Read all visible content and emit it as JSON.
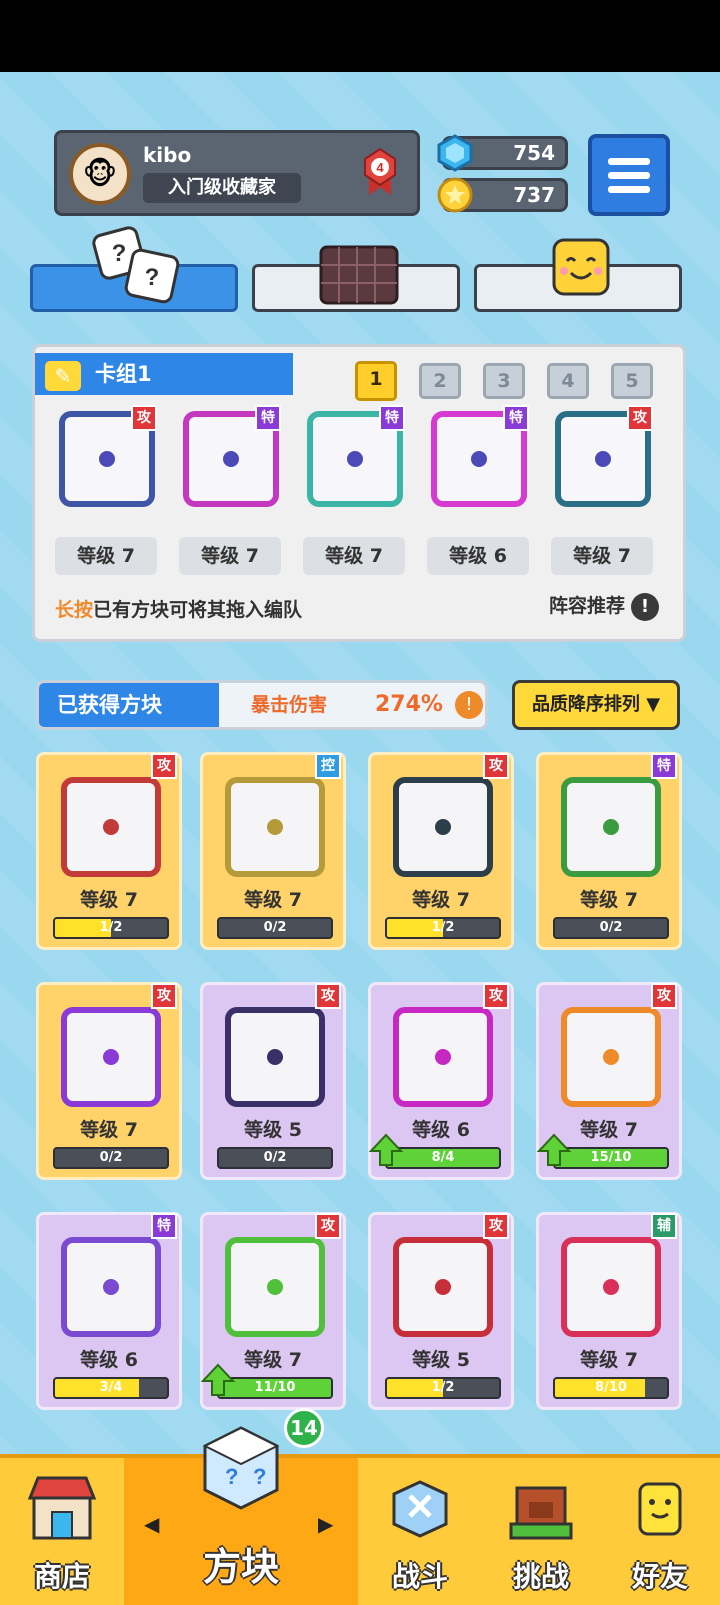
{
  "player": {
    "name": "kibo",
    "title": "入门级收藏家",
    "rank": "4"
  },
  "resources": {
    "gems": "754",
    "coins": "737"
  },
  "deck": {
    "name": "卡组1",
    "tabs": [
      "1",
      "2",
      "3",
      "4",
      "5"
    ],
    "cards": [
      {
        "tag": "攻",
        "level": "等级 7"
      },
      {
        "tag": "特",
        "level": "等级 7"
      },
      {
        "tag": "特",
        "level": "等级 7"
      },
      {
        "tag": "特",
        "level": "等级 6"
      },
      {
        "tag": "攻",
        "level": "等级 7"
      }
    ],
    "hint_strong": "长按",
    "hint_rest": "已有方块可将其拖入编队",
    "recommend": "阵容推荐"
  },
  "owned": {
    "label": "已获得方块",
    "crit_label": "暴击伤害",
    "crit_value": "274%",
    "sort": "品质降序排列"
  },
  "blocks": [
    {
      "tag": "攻",
      "level": "等级 7",
      "progress": "1/2",
      "fill": 0.5,
      "bg": "#ffd26a",
      "border": "#c33b38"
    },
    {
      "tag": "控",
      "level": "等级 7",
      "progress": "0/2",
      "fill": 0,
      "bg": "#ffd26a",
      "border": "#b59a3a"
    },
    {
      "tag": "攻",
      "level": "等级 7",
      "progress": "1/2",
      "fill": 0.5,
      "bg": "#ffd26a",
      "border": "#2c3e4a"
    },
    {
      "tag": "特",
      "level": "等级 7",
      "progress": "0/2",
      "fill": 0,
      "bg": "#ffd26a",
      "border": "#3a9b3f"
    },
    {
      "tag": "攻",
      "level": "等级 7",
      "progress": "0/2",
      "fill": 0,
      "bg": "#ffd26a",
      "border": "#8a3ad6"
    },
    {
      "tag": "攻",
      "level": "等级 5",
      "progress": "0/2",
      "fill": 0,
      "bg": "#dcc6f2",
      "border": "#3a2f66"
    },
    {
      "tag": "攻",
      "level": "等级 6",
      "progress": "8/4",
      "fill": 1,
      "bg": "#dcc6f2",
      "border": "#c728c4",
      "up": true
    },
    {
      "tag": "攻",
      "level": "等级 7",
      "progress": "15/10",
      "fill": 1,
      "bg": "#dcc6f2",
      "border": "#ef8a2a",
      "up": true
    },
    {
      "tag": "特",
      "level": "等级 6",
      "progress": "3/4",
      "fill": 0.75,
      "bg": "#dcc6f2",
      "border": "#7a4ad0"
    },
    {
      "tag": "攻",
      "level": "等级 7",
      "progress": "11/10",
      "fill": 1,
      "bg": "#dcc6f2",
      "border": "#4fbf3c",
      "up": true
    },
    {
      "tag": "攻",
      "level": "等级 5",
      "progress": "1/2",
      "fill": 0.5,
      "bg": "#dcc6f2",
      "border": "#c62f3a"
    },
    {
      "tag": "辅",
      "level": "等级 7",
      "progress": "8/10",
      "fill": 0.8,
      "bg": "#dcc6f2",
      "border": "#d9305a"
    }
  ],
  "nav": {
    "shop": "商店",
    "blocks": "方块",
    "battle": "战斗",
    "challenge": "挑战",
    "friends": "好友",
    "badge": "14"
  }
}
